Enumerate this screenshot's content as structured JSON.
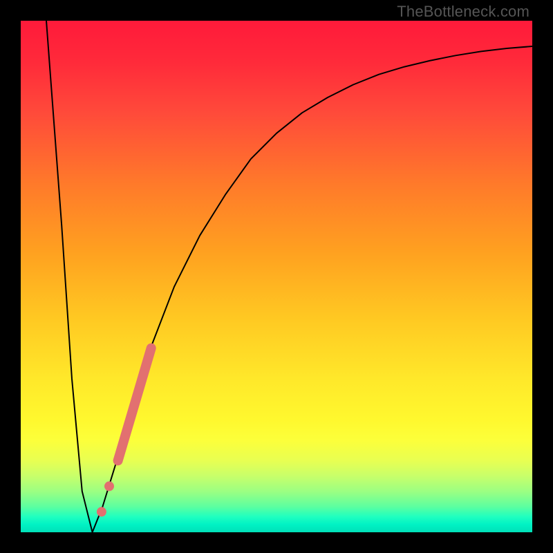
{
  "watermark": "TheBottleneck.com",
  "chart_data": {
    "type": "line",
    "title": "",
    "xlabel": "",
    "ylabel": "",
    "xlim": [
      0,
      100
    ],
    "ylim": [
      0,
      100
    ],
    "grid": false,
    "series": [
      {
        "name": "bottleneck-curve",
        "x": [
          5,
          8,
          10,
          12,
          14,
          16,
          20,
          25,
          30,
          35,
          40,
          45,
          50,
          55,
          60,
          65,
          70,
          75,
          80,
          85,
          90,
          95,
          100
        ],
        "values": [
          100,
          60,
          30,
          8,
          0,
          5,
          18,
          35,
          48,
          58,
          66,
          73,
          78,
          82,
          85,
          87.5,
          89.5,
          91,
          92.2,
          93.2,
          94,
          94.6,
          95
        ]
      }
    ],
    "annotations": [
      {
        "name": "salmon-segment",
        "type": "thick-line",
        "color": "#e27070",
        "width": 12,
        "points_x": [
          19.0,
          25.5
        ],
        "points_y": [
          14,
          36
        ]
      },
      {
        "name": "salmon-dot-1",
        "type": "dot",
        "color": "#e27070",
        "radius": 6,
        "x": 17.3,
        "y": 9
      },
      {
        "name": "salmon-dot-2",
        "type": "dot",
        "color": "#e27070",
        "radius": 6,
        "x": 15.8,
        "y": 4
      }
    ]
  }
}
